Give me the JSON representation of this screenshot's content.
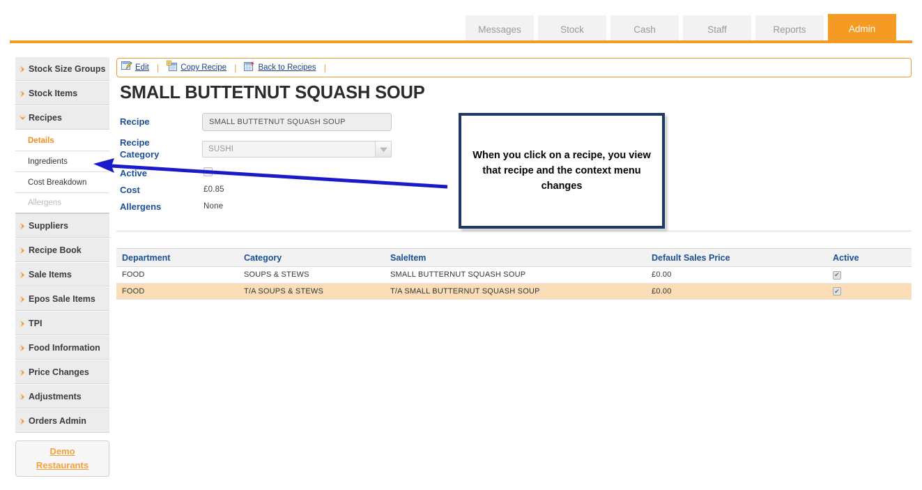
{
  "header": {
    "logo_text": "",
    "tabs": [
      {
        "label": "Messages",
        "active": false
      },
      {
        "label": "Stock",
        "active": false
      },
      {
        "label": "Cash",
        "active": false
      },
      {
        "label": "Staff",
        "active": false
      },
      {
        "label": "Reports",
        "active": false
      },
      {
        "label": "Admin",
        "active": true
      }
    ],
    "accent_color": "#f59a23"
  },
  "sidebar": {
    "items": [
      {
        "label": "Stock Size Groups",
        "icon": "chevron-right-icon",
        "expanded": false
      },
      {
        "label": "Stock Items",
        "icon": "chevron-right-icon",
        "expanded": false
      },
      {
        "label": "Recipes",
        "icon": "chevron-down-icon",
        "expanded": true
      }
    ],
    "sub_items": [
      {
        "label": "Details",
        "state": "selected"
      },
      {
        "label": "Ingredients",
        "state": "normal"
      },
      {
        "label": "Cost Breakdown",
        "state": "normal"
      },
      {
        "label": "Allergens",
        "state": "disabled"
      }
    ],
    "items_after": [
      {
        "label": "Suppliers",
        "icon": "chevron-right-icon"
      },
      {
        "label": "Recipe Book",
        "icon": "chevron-right-icon"
      },
      {
        "label": "Sale Items",
        "icon": "chevron-right-icon"
      },
      {
        "label": "Epos Sale Items",
        "icon": "chevron-right-icon"
      },
      {
        "label": "TPI",
        "icon": "chevron-right-icon"
      },
      {
        "label": "Food Information",
        "icon": "chevron-right-icon"
      },
      {
        "label": "Price Changes",
        "icon": "chevron-right-icon"
      },
      {
        "label": "Adjustments",
        "icon": "chevron-right-icon"
      },
      {
        "label": "Orders Admin",
        "icon": "chevron-right-icon"
      }
    ],
    "demo_button": {
      "line1": "Demo",
      "line2": "Restaurants"
    }
  },
  "toolbar": {
    "links": [
      {
        "label": "Edit",
        "icon": "edit-pencil-icon"
      },
      {
        "label": "Copy Recipe",
        "icon": "copy-recipe-icon"
      },
      {
        "label": "Back to Recipes",
        "icon": "back-to-recipes-icon"
      }
    ],
    "separator": "|"
  },
  "main": {
    "page_title": "SMALL BUTTETNUT SQUASH SOUP",
    "form": {
      "recipe_label": "Recipe",
      "recipe_value": "SMALL BUTTETNUT SQUASH SOUP",
      "category_label_line1": "Recipe",
      "category_label_line2": "Category",
      "category_value": "SUSHI",
      "active_label": "Active",
      "active_checked": true,
      "cost_label": "Cost",
      "cost_value": "£0.85",
      "allergens_label": "Allergens",
      "allergens_value": "None"
    },
    "table": {
      "columns": [
        "Department",
        "Category",
        "SaleItem",
        "Default Sales Price",
        "Active"
      ],
      "rows": [
        {
          "department": "FOOD",
          "category": "SOUPS & STEWS",
          "saleitem": "SMALL BUTTERNUT SQUASH SOUP",
          "price": "£0.00",
          "active": true
        },
        {
          "department": "FOOD",
          "category": "T/A SOUPS & STEWS",
          "saleitem": "T/A SMALL BUTTERNUT SQUASH SOUP",
          "price": "£0.00",
          "active": true
        }
      ]
    }
  },
  "annotation": {
    "callout_text": "When you click on a recipe, you view that recipe and the context menu changes",
    "border_color": "#1f3864",
    "arrow_color": "#1a1ac8"
  }
}
